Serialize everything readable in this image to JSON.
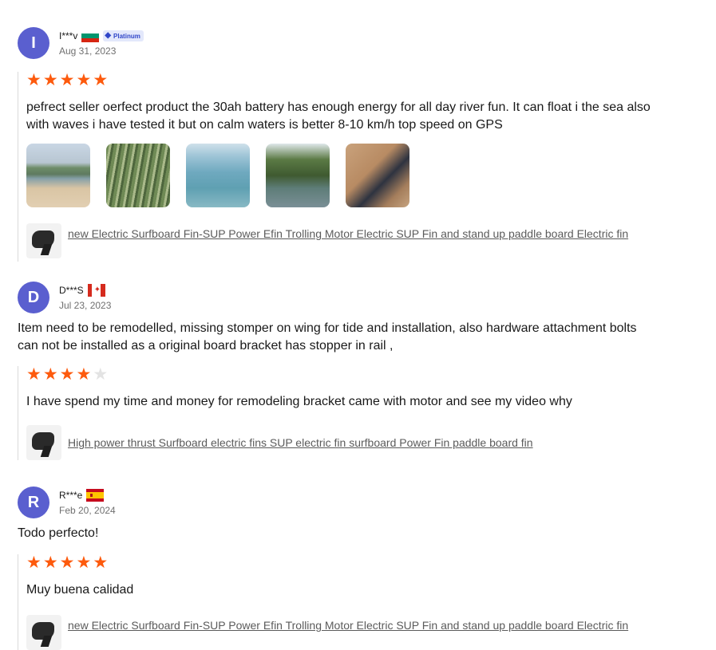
{
  "reviews": [
    {
      "avatar_letter": "I",
      "user": "I***v",
      "country_flag": "bulgaria-flag",
      "badge": "Platinum",
      "date": "Aug 31, 2023",
      "rating": 5,
      "text": "pefrect seller oerfect product the 30ah battery has enough energy for all day river fun. It can float i the sea also with waves i have tested it but on calm waters is better 8-10 km/h top speed on GPS",
      "photo_count": 5,
      "product_link": "new Electric Surfboard Fin-SUP Power Efin Trolling Motor Electric SUP Fin and stand up paddle board Electric fin"
    },
    {
      "avatar_letter": "D",
      "user": "D***S",
      "country_flag": "canada-flag",
      "date": "Jul 23, 2023",
      "initial_text": "Item need to be remodelled, missing stomper on wing for tide and installation, also hardware attachment bolts can not be installed as a original board bracket has stopper in rail ,",
      "rating": 4,
      "text": "I have spend my time and money for remodeling bracket came with motor and see my video why",
      "product_link": "High power thrust Surfboard electric fins SUP electric fin surfboard Power Fin paddle board fin"
    },
    {
      "avatar_letter": "R",
      "user": "R***e",
      "country_flag": "spain-flag",
      "date": "Feb 20, 2024",
      "initial_text": "Todo perfecto!",
      "rating": 5,
      "text": "Muy buena calidad",
      "product_link": "new Electric Surfboard Fin-SUP Power Efin Trolling Motor Electric SUP Fin and stand up paddle board Electric fin"
    }
  ],
  "colors": {
    "avatar": "#5a5fcf",
    "star_active": "#fd5a0d",
    "star_inactive": "#e3e3e3",
    "link": "#5b5b5b",
    "badge_bg": "#e3e8fb",
    "badge_text": "#3046c8"
  }
}
